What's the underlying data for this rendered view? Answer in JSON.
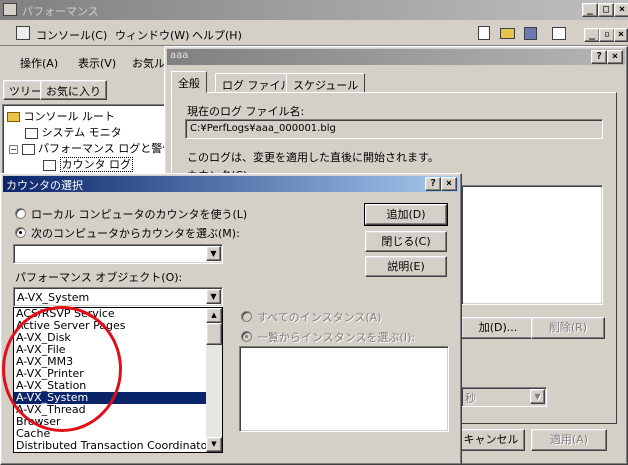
{
  "main_window": {
    "title": "パフォーマンス",
    "menu": [
      "コンソール(C)",
      "ウィンドウ(W)",
      "ヘルプ(H)"
    ],
    "toolbar2": [
      "操作(A)",
      "表示(V)",
      "お気ル"
    ],
    "tabs": [
      "ツリー",
      "お気に入り"
    ],
    "tree": [
      "コンソール ルート",
      "システム モニタ",
      "パフォーマンス ログと警告",
      "カウンタ ログ"
    ]
  },
  "props_dialog": {
    "title": "aaa",
    "tabs": [
      "全般",
      "ログ ファイル",
      "スケジュール"
    ],
    "current_log_label": "現在のログ ファイル名:",
    "current_log_value": "C:¥PerfLogs¥aaa_000001.blg",
    "start_note": "このログは、変更を適用した直後に開始されます。",
    "counters_partial": "カウンタ(C)",
    "add_partial": "加(D)...",
    "remove_label": "削除(R)",
    "seconds_label": "秒",
    "cancel_label": "キャンセル",
    "apply_label": "適用(A)"
  },
  "counter_dialog": {
    "title": "カウンタの選択",
    "radio_local": "ローカル コンピュータのカウンタを使う(L)",
    "radio_select": "次のコンピュータからカウンタを選ぶ(M):",
    "computer_value": "",
    "perf_object_label": "パフォーマンス オブジェクト(O):",
    "perf_object_value": "A-VX_System",
    "buttons": {
      "add": "追加(D)",
      "close": "閉じる(C)",
      "explain": "説明(E)"
    },
    "radio_all_instances": "すべてのインスタンス(A)",
    "radio_select_instances": "一覧からインスタンスを選ぶ(I):",
    "objects": [
      "ACS/RSVP Service",
      "Active Server Pages",
      "A-VX_Disk",
      "A-VX_File",
      "A-VX_MM3",
      "A-VX_Printer",
      "A-VX_Station",
      "A-VX_System",
      "A-VX_Thread",
      "Browser",
      "Cache",
      "Distributed Transaction Coordinator"
    ],
    "selected_index": 7
  }
}
